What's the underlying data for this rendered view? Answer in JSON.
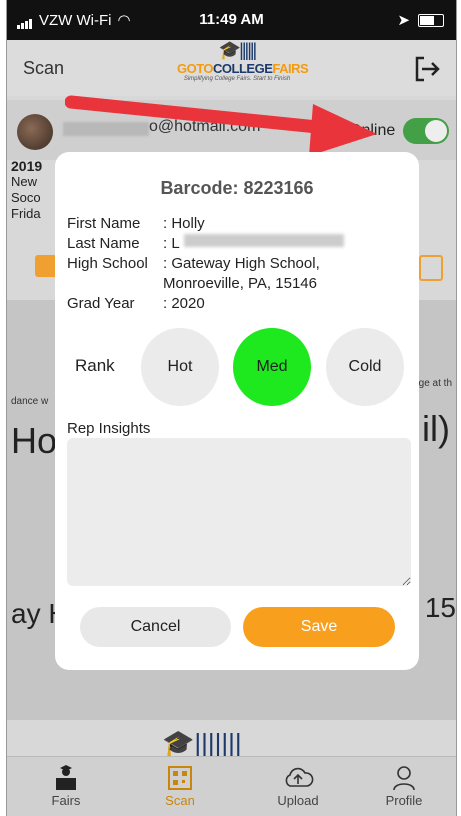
{
  "status": {
    "carrier": "VZW Wi-Fi",
    "time": "11:49 AM"
  },
  "header": {
    "title": "Scan",
    "logo_text_1": "GOTO",
    "logo_text_2": "COLLEGE",
    "logo_text_3": "FAIRS",
    "logo_tagline": "Simplifying College Fairs. Start to Finish"
  },
  "user": {
    "email_suffix": "o@hotmail.com",
    "online_label": "Online",
    "online": true
  },
  "background": {
    "fair_year": "2019",
    "fair_lines": [
      "New",
      "Soco",
      "Frida"
    ],
    "doc_text_1": "dance w",
    "doc_text_2": "Holl",
    "doc_text_3": "ge at th",
    "doc_text_4": "il)",
    "doc_text_5": "ay H",
    "doc_text_6": ", 15"
  },
  "modal": {
    "barcode_label": "Barcode: 8223166",
    "fields": [
      {
        "label": "First Name",
        "value": ": Holly"
      },
      {
        "label": "Last Name",
        "value": ": L"
      },
      {
        "label": "High School",
        "value": ": Gateway High School,\n  Monroeville, PA, 15146"
      },
      {
        "label": "Grad Year",
        "value": ": 2020"
      }
    ],
    "rank_label": "Rank",
    "rank_options": [
      "Hot",
      "Med",
      "Cold"
    ],
    "rank_selected": "Med",
    "rank_selected_color": "#1ee81e",
    "insights_label": "Rep Insights",
    "insights_value": "",
    "cancel_label": "Cancel",
    "save_label": "Save",
    "save_color": "#f8a01e"
  },
  "tabs": [
    {
      "label": "Fairs",
      "icon": "fairs-icon"
    },
    {
      "label": "Scan",
      "icon": "scan-icon",
      "active": true
    },
    {
      "label": "Upload",
      "icon": "upload-icon"
    },
    {
      "label": "Profile",
      "icon": "profile-icon"
    }
  ]
}
